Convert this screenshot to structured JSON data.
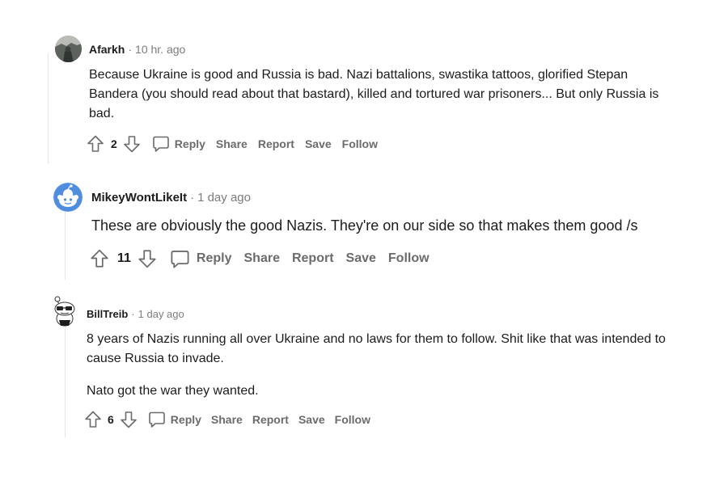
{
  "comments": [
    {
      "username": "Afarkh",
      "time": "10 hr. ago",
      "paragraphs": [
        "Because Ukraine is good and Russia is bad. Nazi battalions, swastika tattoos, glorified Stepan Bandera (you should read about that bastard), killed and tortured war prisoners... But only Russia is bad."
      ],
      "score": "2",
      "actions": {
        "reply": "Reply",
        "share": "Share",
        "report": "Report",
        "save": "Save",
        "follow": "Follow"
      }
    },
    {
      "username": "MikeyWontLikeIt",
      "time": "1 day ago",
      "paragraphs": [
        "These are obviously the good Nazis. They're on our side so that makes them good /s"
      ],
      "score": "11",
      "actions": {
        "reply": "Reply",
        "share": "Share",
        "report": "Report",
        "save": "Save",
        "follow": "Follow"
      }
    },
    {
      "username": "BillTreib",
      "time": "1 day ago",
      "paragraphs": [
        "8 years of Nazis running all over Ukraine and no laws for them to follow. Shit like that was intended to cause Russia to invade.",
        "Nato got the war they wanted."
      ],
      "score": "6",
      "actions": {
        "reply": "Reply",
        "share": "Share",
        "report": "Report",
        "save": "Save",
        "follow": "Follow"
      }
    }
  ],
  "meta_separator": "·",
  "colors": {
    "text": "#1c1c1c",
    "muted": "#7c7c7c",
    "action": "#6b6b6b",
    "thread_line": "#e5e5e5",
    "snoo_blue": "#4f8dde"
  },
  "icons": {
    "upvote": "arrow-up-outline-icon",
    "downvote": "arrow-down-outline-icon",
    "reply": "speech-bubble-icon"
  }
}
